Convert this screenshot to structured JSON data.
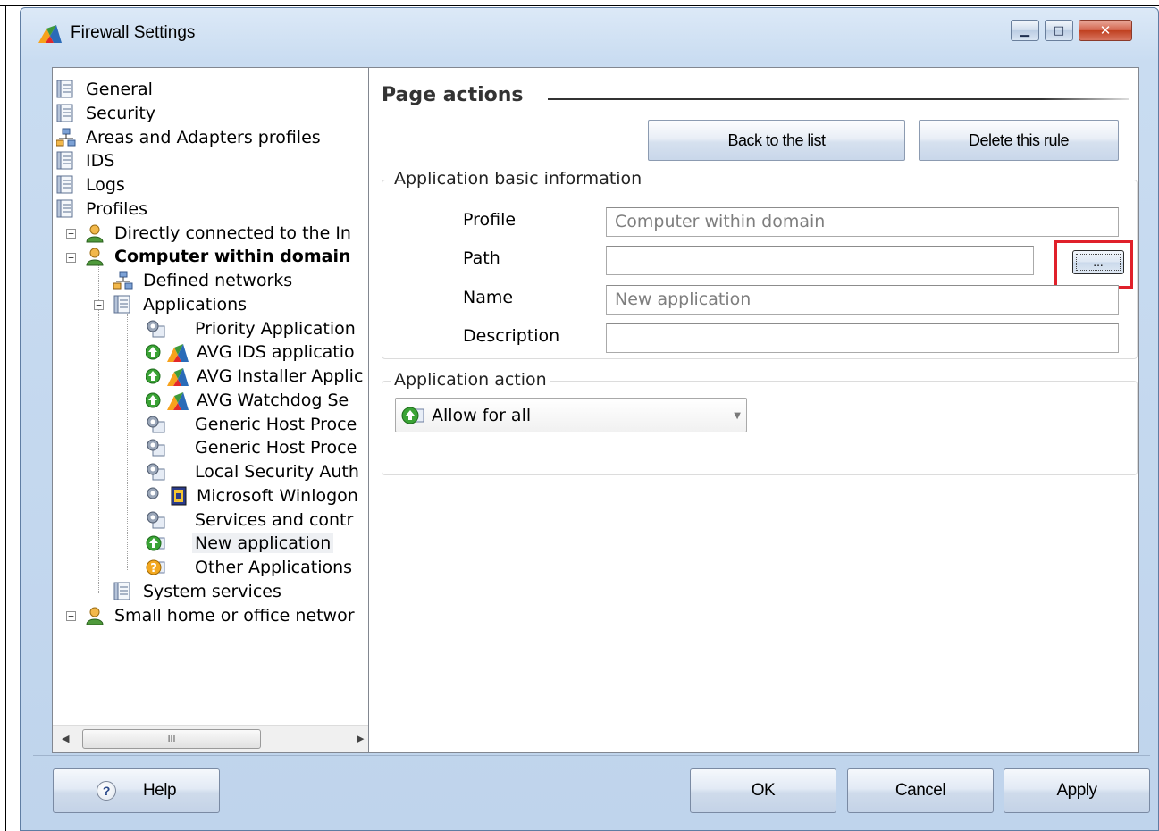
{
  "window": {
    "title": "Firewall Settings",
    "minimize_glyph": "▁",
    "maximize_glyph": "□",
    "close_glyph": "✕"
  },
  "tree": {
    "items": [
      {
        "label": "General",
        "icon": "document-icon",
        "level": 0
      },
      {
        "label": "Security",
        "icon": "document-icon",
        "level": 0
      },
      {
        "label": "Areas and Adapters profiles",
        "icon": "network-icon",
        "level": 0
      },
      {
        "label": "IDS",
        "icon": "document-icon",
        "level": 0
      },
      {
        "label": "Logs",
        "icon": "document-icon",
        "level": 0
      },
      {
        "label": "Profiles",
        "icon": "document-icon",
        "level": 0
      },
      {
        "label": "Directly connected to the In",
        "icon": "user-icon",
        "level": 1
      },
      {
        "label": "Computer within domain",
        "icon": "user-icon",
        "level": 1
      },
      {
        "label": "Defined networks",
        "icon": "network-icon",
        "level": 2
      },
      {
        "label": "Applications",
        "icon": "document-icon",
        "level": 2
      },
      {
        "label": "Priority Application",
        "icon": "gear-icon",
        "level": 3
      },
      {
        "label": "AVG IDS applicatio",
        "icon": "avg-app-icon",
        "level": 3
      },
      {
        "label": "AVG Installer Applic",
        "icon": "avg-app-icon",
        "level": 3
      },
      {
        "label": "AVG Watchdog Se",
        "icon": "avg-app-icon",
        "level": 3
      },
      {
        "label": "Generic Host Proce",
        "icon": "gear-icon",
        "level": 3
      },
      {
        "label": "Generic Host Proce",
        "icon": "gear-icon",
        "level": 3
      },
      {
        "label": "Local Security Auth",
        "icon": "gear-icon",
        "level": 3
      },
      {
        "label": "Microsoft Winlogon",
        "icon": "gear-lock-icon",
        "level": 3
      },
      {
        "label": "Services and contr",
        "icon": "gear-icon",
        "level": 3
      },
      {
        "label": "New application",
        "icon": "allow-icon",
        "level": 3
      },
      {
        "label": "Other Applications",
        "icon": "question-icon",
        "level": 3
      },
      {
        "label": "System services",
        "icon": "document-icon",
        "level": 2
      },
      {
        "label": "Small home or office networ",
        "icon": "user-icon",
        "level": 1
      }
    ],
    "scroll_thumb_glyph": "III",
    "scroll_left": "◀",
    "scroll_right": "▶"
  },
  "page_actions": {
    "title": "Page actions",
    "back_button": "Back to the list",
    "delete_button": "Delete this rule"
  },
  "basic_info": {
    "group_title": "Application basic information",
    "profile_label": "Profile",
    "profile_value": "Computer within domain",
    "path_label": "Path",
    "path_value": "",
    "browse_button": "...",
    "name_label": "Name",
    "name_value": "New application",
    "description_label": "Description",
    "description_value": ""
  },
  "action": {
    "group_title": "Application action",
    "selected": "Allow for all",
    "chevron": "▼"
  },
  "footer": {
    "help": "Help",
    "help_glyph": "?",
    "ok": "OK",
    "cancel": "Cancel",
    "apply": "Apply"
  },
  "colors": {
    "highlight": "#e0202a",
    "allow_green": "#3aa335",
    "avg_orange": "#f28c28"
  }
}
